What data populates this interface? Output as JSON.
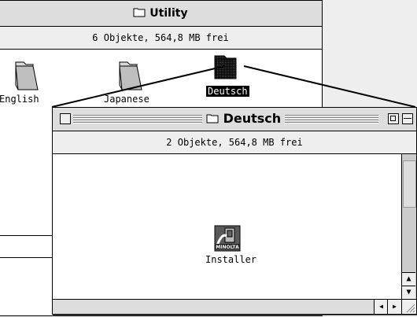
{
  "back_window": {
    "title": "Utility",
    "status": "6 Objekte, 564,8 MB frei",
    "items": [
      {
        "label": "English",
        "icon": "folder-icon",
        "selected": false
      },
      {
        "label": "Japanese",
        "icon": "folder-icon",
        "selected": false
      },
      {
        "label": "Deutsch",
        "icon": "folder-open-icon",
        "selected": true
      }
    ]
  },
  "front_window": {
    "title": "Deutsch",
    "status": "2 Objekte, 564,8 MB frei",
    "items": [
      {
        "label": "Installer",
        "icon": "installer-icon",
        "badge": "MINOLTA"
      }
    ]
  },
  "scrollbar": {
    "up": "▲",
    "down": "▼",
    "left": "◀",
    "right": "▶"
  }
}
